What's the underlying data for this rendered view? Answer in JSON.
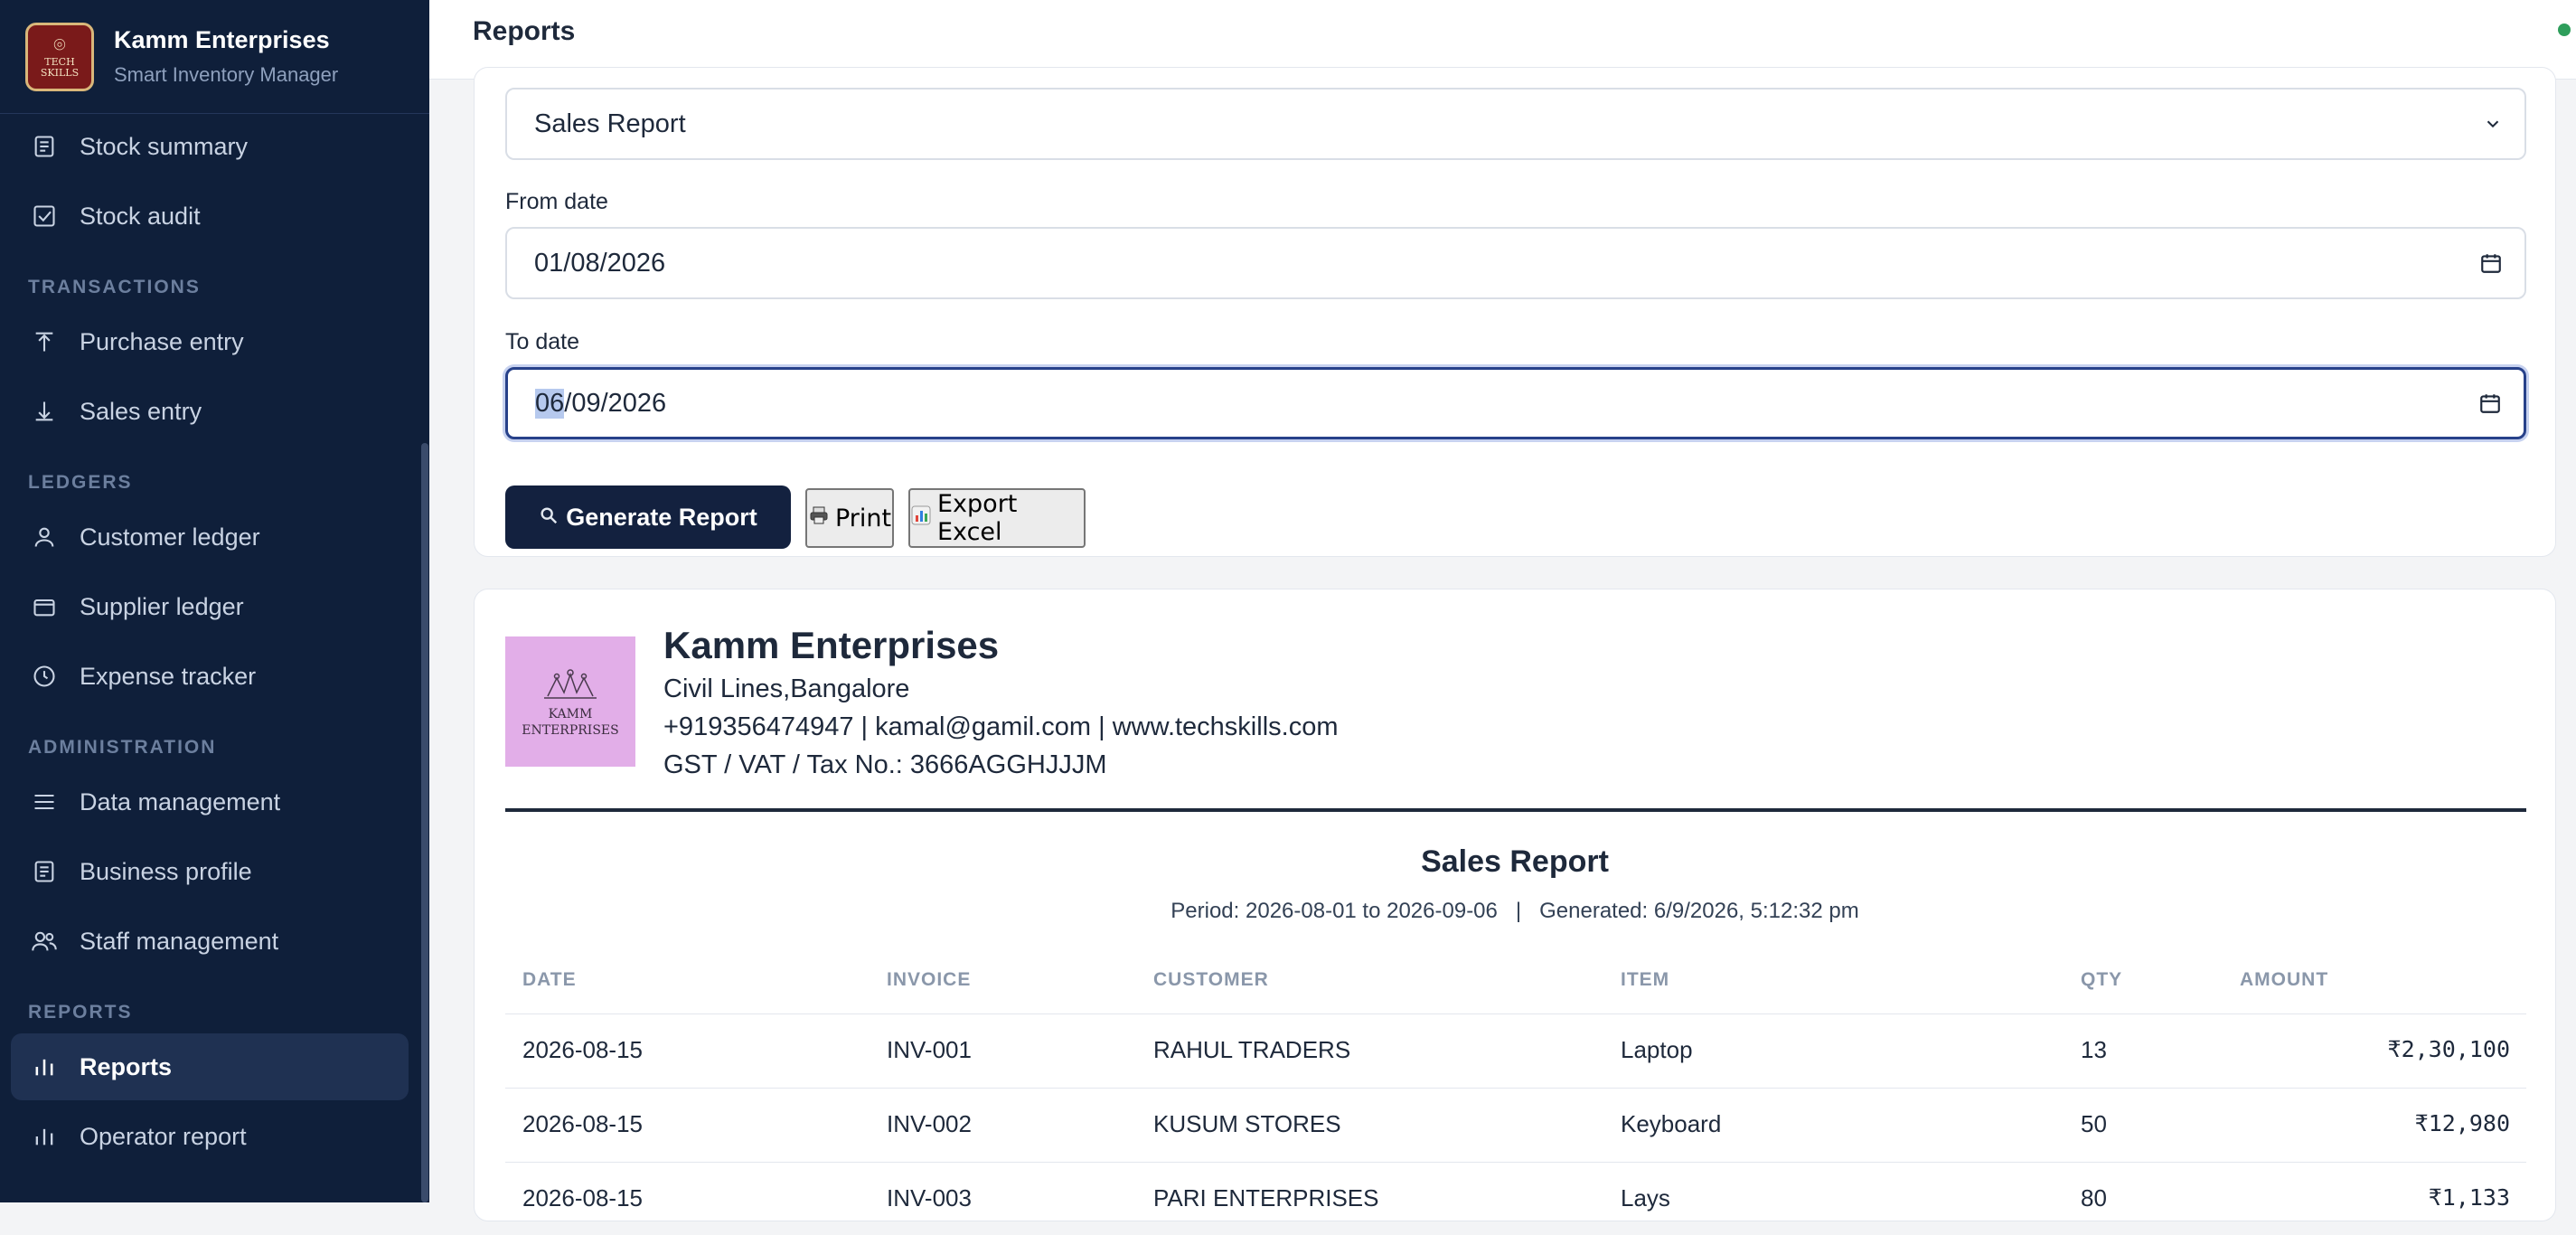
{
  "sidebar": {
    "brand_name": "Kamm Enterprises",
    "brand_sub": "Smart Inventory Manager",
    "logo_lines": [
      "TECH",
      "SKILLS"
    ],
    "items": [
      {
        "label": "Stock summary",
        "icon": "document-icon"
      },
      {
        "label": "Stock audit",
        "icon": "checkbox-icon"
      },
      {
        "label": "Purchase entry",
        "icon": "arrow-up-icon"
      },
      {
        "label": "Sales entry",
        "icon": "arrow-down-icon"
      },
      {
        "label": "Customer ledger",
        "icon": "user-icon"
      },
      {
        "label": "Supplier ledger",
        "icon": "wallet-icon"
      },
      {
        "label": "Expense tracker",
        "icon": "clock-icon"
      },
      {
        "label": "Data management",
        "icon": "menu-icon"
      },
      {
        "label": "Business profile",
        "icon": "document-icon"
      },
      {
        "label": "Staff management",
        "icon": "users-icon"
      },
      {
        "label": "Reports",
        "icon": "bar-chart-icon",
        "active": true
      },
      {
        "label": "Operator report",
        "icon": "bar-chart-icon"
      }
    ],
    "sections": {
      "transactions": "TRANSACTIONS",
      "ledgers": "LEDGERS",
      "administration": "ADMINISTRATION",
      "reports": "REPORTS"
    }
  },
  "topbar": {
    "title": "Reports"
  },
  "form": {
    "report_type": "Sales Report",
    "from_label": "From date",
    "from_value": "01/08/2026",
    "to_label": "To date",
    "to_value_selected": "06",
    "to_value_rest": "/09/2026",
    "generate_label": "Generate Report",
    "print_label": "Print",
    "export_label": "Export Excel"
  },
  "business": {
    "name": "Kamm Enterprises",
    "address": "Civil Lines,Bangalore",
    "contact": "+919356474947 | kamal@gamil.com | www.techskills.com",
    "tax": "GST / VAT / Tax No.: 3666AGGHJJJM",
    "logo_lines": [
      "KAMM",
      "ENTERPRISES"
    ]
  },
  "report": {
    "title": "Sales Report",
    "meta": "Period: 2026-08-01 to 2026-09-06   |   Generated: 6/9/2026, 5:12:32 pm",
    "columns": [
      "DATE",
      "INVOICE",
      "CUSTOMER",
      "ITEM",
      "QTY",
      "AMOUNT"
    ],
    "rows": [
      {
        "date": "2026-08-15",
        "invoice": "INV-001",
        "customer": "RAHUL TRADERS",
        "item": "Laptop",
        "qty": "13",
        "amount": "₹2,30,100"
      },
      {
        "date": "2026-08-15",
        "invoice": "INV-002",
        "customer": "KUSUM STORES",
        "item": "Keyboard",
        "qty": "50",
        "amount": "₹12,980"
      },
      {
        "date": "2026-08-15",
        "invoice": "INV-003",
        "customer": "PARI ENTERPRISES",
        "item": "Lays",
        "qty": "80",
        "amount": "₹1,133"
      }
    ]
  },
  "colors": {
    "sidebar_bg": "#0f1f3a",
    "active_bg": "#1f3152",
    "primary": "#13213f",
    "status": "#2e9e5b"
  }
}
